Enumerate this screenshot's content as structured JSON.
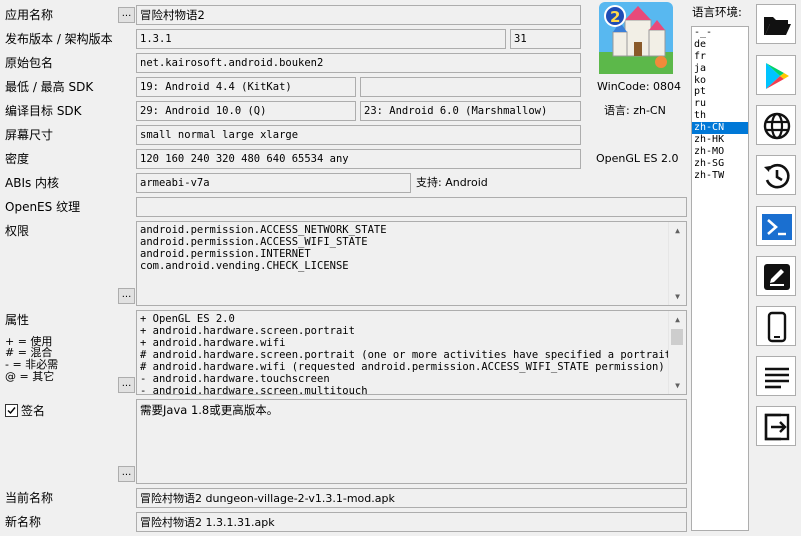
{
  "labels": {
    "app_name": "应用名称",
    "version": "发布版本 / 架构版本",
    "package": "原始包名",
    "sdk": "最低 / 最高 SDK",
    "target_sdk": "编译目标 SDK",
    "screen": "屏幕尺寸",
    "density": "密度",
    "abi": "ABIs 内核",
    "opengl_tex": "OpenES 纹理",
    "permissions": "权限",
    "features": "属性",
    "legend": [
      "+ = 使用",
      "# = 混合",
      "- = 非必需",
      "@ = 其它"
    ],
    "signature": "签名",
    "current_name": "当前名称",
    "new_name": "新名称",
    "lang_env": "语言环境:"
  },
  "values": {
    "app_name": "冒险村物语2",
    "version_name": "1.3.1",
    "version_code": "31",
    "package": "net.kairosoft.android.bouken2",
    "min_sdk": "19: Android 4.4 (KitKat)",
    "max_sdk": "",
    "target_sdk": "29: Android 10.0 (Q)",
    "compile_sdk": "23: Android 6.0 (Marshmallow)",
    "screen": "small normal large xlarge",
    "density": "120 160 240 320 480 640 65534 any",
    "abi": "armeabi-v7a",
    "abi_support": "支持: Android",
    "opengl_tex": "",
    "permissions": [
      "android.permission.ACCESS_NETWORK_STATE",
      "android.permission.ACCESS_WIFI_STATE",
      "android.permission.INTERNET",
      "com.android.vending.CHECK_LICENSE"
    ],
    "features": [
      "+ OpenGL ES 2.0",
      "+ android.hardware.screen.portrait",
      "+ android.hardware.wifi",
      "# android.hardware.screen.portrait (one or more activities have specified a portrait ori",
      "# android.hardware.wifi (requested android.permission.ACCESS_WIFI_STATE permission)",
      "- android.hardware.touchscreen",
      "- android.hardware.screen.multitouch"
    ],
    "signature_checked": true,
    "signature_text": "需要Java 1.8或更高版本。",
    "current_name": "冒险村物语2 dungeon-village-2-v1.3.1-mod.apk",
    "new_name": "冒险村物语2 1.3.1.31.apk"
  },
  "info": {
    "wincode": "WinCode: 0804",
    "lang": "语言: zh-CN",
    "opengl": "OpenGL ES 2.0"
  },
  "dots": "...",
  "languages": [
    "-_-",
    "de",
    "fr",
    "ja",
    "ko",
    "pt",
    "ru",
    "th",
    "zh-CN",
    "zh-HK",
    "zh-MO",
    "zh-SG",
    "zh-TW"
  ],
  "selected_language": "zh-CN",
  "sidebar_buttons": [
    "folder-open-icon",
    "google-play-icon",
    "globe-icon",
    "history-icon",
    "powershell-icon",
    "edit-icon",
    "phone-icon",
    "menu-lines-icon",
    "exit-icon"
  ],
  "colors": {
    "accent": "#0078d7",
    "border": "#adadad"
  }
}
